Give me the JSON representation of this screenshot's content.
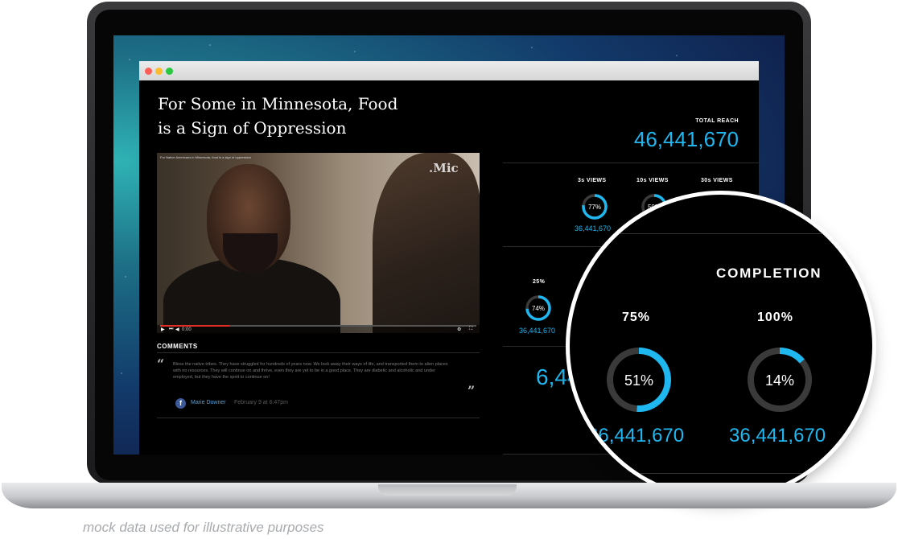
{
  "article": {
    "headline_line1": "For Some in Minnesota, Food",
    "headline_line2": "is a Sign of Oppression"
  },
  "video": {
    "title": "For Native Americans in Minnesota, food is a sign of oppression",
    "brand": ".Mic",
    "time": "0:00"
  },
  "comments": {
    "label": "COMMENTS",
    "open_quote": "“",
    "close_quote": "”",
    "text": "Bless the native tribes. They have struggled for hundreds of years now. We look away their ways of life, and transported them to alien places with no resources. They will continue on and thrive, even they are yet to be in a good place. They are diabetic and alcoholic and under employed, but they have the spirit to continue on!",
    "fb_icon": "f",
    "author": "Marie Downer",
    "date": "February 9 at 6:47pm"
  },
  "stats": {
    "total_reach_label": "TOTAL REACH",
    "total_reach": "46,441,670",
    "views": [
      {
        "label": "3s VIEWS",
        "pct": "77%",
        "value": 0.77,
        "count": "36,441,670"
      },
      {
        "label": "10s VIEWS",
        "pct": "50%",
        "value": 0.5
      },
      {
        "label": "30s VIEWS"
      }
    ],
    "completion_small": {
      "label": "25%",
      "pct": "74%",
      "value": 0.74,
      "count": "36,441,670"
    },
    "partial_big_number": "6,44"
  },
  "magnifier": {
    "title": "COMPLETION",
    "items": [
      {
        "label": "75%",
        "pct": "51%",
        "value": 0.51,
        "count": "36,441,670"
      },
      {
        "label": "100%",
        "pct": "14%",
        "value": 0.14,
        "count": "36,441,670"
      }
    ]
  },
  "caption": "mock data used for illustrative purposes",
  "colors": {
    "accent": "#1fb7f0",
    "track": "#3a3a3a",
    "close": "#fc5f57",
    "minimize": "#fdbd2e",
    "zoom": "#28c840"
  }
}
